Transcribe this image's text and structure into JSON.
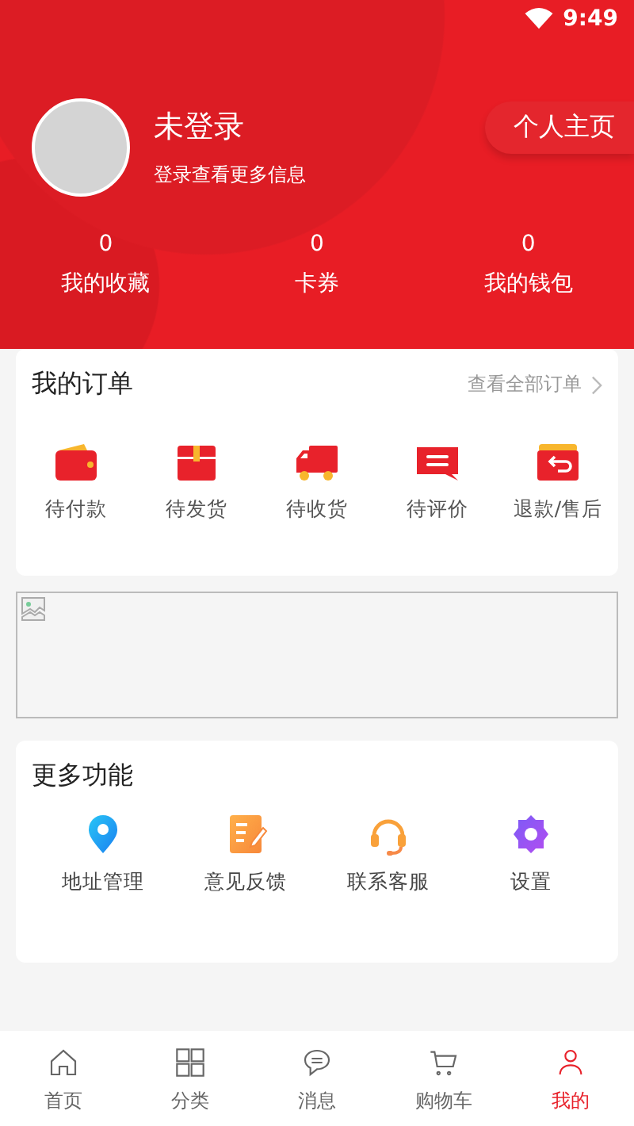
{
  "status_bar": {
    "time": "9:49"
  },
  "profile": {
    "name": "未登录",
    "subtitle": "登录查看更多信息",
    "home_button": "个人主页"
  },
  "stats": [
    {
      "value": "0",
      "label": "我的收藏"
    },
    {
      "value": "0",
      "label": "卡券"
    },
    {
      "value": "0",
      "label": "我的钱包"
    }
  ],
  "orders": {
    "title": "我的订单",
    "view_all": "查看全部订单",
    "items": [
      {
        "kind": "wallet",
        "label": "待付款"
      },
      {
        "kind": "box",
        "label": "待发货"
      },
      {
        "kind": "truck",
        "label": "待收货"
      },
      {
        "kind": "review",
        "label": "待评价"
      },
      {
        "kind": "refund",
        "label": "退款/售后"
      }
    ]
  },
  "banner": {
    "kind": "broken-image"
  },
  "more": {
    "title": "更多功能",
    "items": [
      {
        "kind": "location",
        "label": "地址管理"
      },
      {
        "kind": "feedback",
        "label": "意见反馈"
      },
      {
        "kind": "service",
        "label": "联系客服"
      },
      {
        "kind": "settings",
        "label": "设置"
      }
    ]
  },
  "tab_bar": [
    {
      "kind": "home",
      "label": "首页",
      "selected": false
    },
    {
      "kind": "grid",
      "label": "分类",
      "selected": false
    },
    {
      "kind": "chat",
      "label": "消息",
      "selected": false
    },
    {
      "kind": "cart",
      "label": "购物车",
      "selected": false
    },
    {
      "kind": "user",
      "label": "我的",
      "selected": true
    }
  ]
}
